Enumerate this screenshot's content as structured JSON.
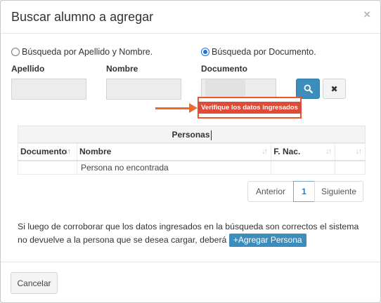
{
  "modal": {
    "title": "Buscar alumno a agregar",
    "close_symbol": "×"
  },
  "search_mode": {
    "by_name_label": "Búsqueda por Apellido y Nombre.",
    "by_name_checked": false,
    "by_document_label": "Búsqueda por Documento.",
    "by_document_checked": true
  },
  "fields": {
    "apellido_label": "Apellido",
    "apellido_value": "",
    "nombre_label": "Nombre",
    "nombre_value": "",
    "documento_label": "Documento",
    "documento_value": ""
  },
  "buttons": {
    "search_icon": "search-icon",
    "clear_symbol": "✖",
    "add_person_label": "Agregar Persona",
    "cancel_label": "Cancelar"
  },
  "error": {
    "message": "Verifique los datos ingresados",
    "color": "#dd4b39",
    "highlight_color": "#e8592a"
  },
  "table": {
    "caption": "Personas",
    "columns": [
      "Documento",
      "Nombre",
      "F. Nac.",
      ""
    ],
    "rows": [
      [
        "",
        "Persona no encontrada",
        "",
        ""
      ]
    ]
  },
  "pagination": {
    "prev_label": "Anterior",
    "current_page": "1",
    "next_label": "Siguiente"
  },
  "help": {
    "text": "Si luego de corroborar que los datos ingresados en la búsqueda son correctos el sistema no devuelve a la persona que se desea cargar, deberá",
    "add_icon": "+"
  },
  "colors": {
    "primary": "#3c8dbc",
    "danger": "#dd4b39"
  }
}
